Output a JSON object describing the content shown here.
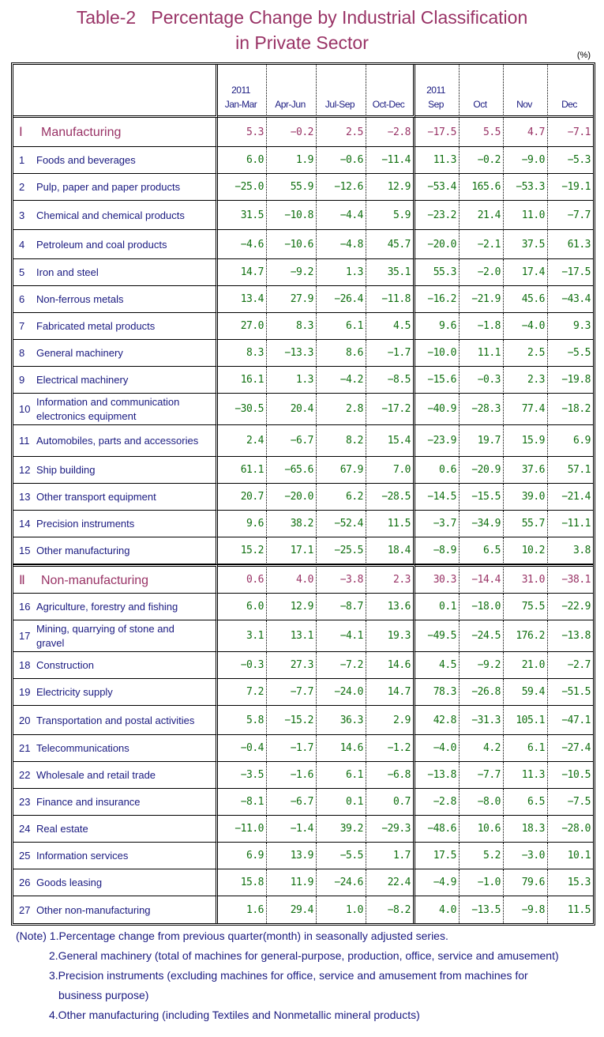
{
  "title": {
    "line1": "Table-2   Percentage Change by Industrial Classification",
    "line2": "in Private Sector"
  },
  "unit": "(%)",
  "header": {
    "columns": [
      {
        "year": "2011",
        "label": "Jan-Mar"
      },
      {
        "year": "",
        "label": "Apr-Jun"
      },
      {
        "year": "",
        "label": "Jul-Sep"
      },
      {
        "year": "",
        "label": "Oct-Dec"
      },
      {
        "year": "2011",
        "label": "Sep"
      },
      {
        "year": "",
        "label": "Oct"
      },
      {
        "year": "",
        "label": "Nov"
      },
      {
        "year": "",
        "label": "Dec"
      }
    ]
  },
  "sections": [
    {
      "roman": "Ⅰ",
      "name": "Manufacturing",
      "values": [
        "5.3",
        "−0.2",
        "2.5",
        "−2.8",
        "−17.5",
        "5.5",
        "4.7",
        "−7.1"
      ],
      "rows": [
        {
          "no": "1",
          "name": "Foods and beverages",
          "values": [
            "6.0",
            "1.9",
            "−0.6",
            "−11.4",
            "11.3",
            "−0.2",
            "−9.0",
            "−5.3"
          ]
        },
        {
          "no": "2",
          "name": "Pulp, paper and paper products",
          "values": [
            "−25.0",
            "55.9",
            "−12.6",
            "12.9",
            "−53.4",
            "165.6",
            "−53.3",
            "−19.1"
          ]
        },
        {
          "no": "3",
          "name": "Chemical and chemical products",
          "values": [
            "31.5",
            "−10.8",
            "−4.4",
            "5.9",
            "−23.2",
            "21.4",
            "11.0",
            "−7.7"
          ]
        },
        {
          "no": "4",
          "name": "Petroleum and coal products",
          "values": [
            "−4.6",
            "−10.6",
            "−4.8",
            "45.7",
            "−20.0",
            "−2.1",
            "37.5",
            "61.3"
          ]
        },
        {
          "no": "5",
          "name": "Iron and steel",
          "values": [
            "14.7",
            "−9.2",
            "1.3",
            "35.1",
            "55.3",
            "−2.0",
            "17.4",
            "−17.5"
          ]
        },
        {
          "no": "6",
          "name": "Non-ferrous metals",
          "values": [
            "13.4",
            "27.9",
            "−26.4",
            "−11.8",
            "−16.2",
            "−21.9",
            "45.6",
            "−43.4"
          ]
        },
        {
          "no": "7",
          "name": "Fabricated metal products",
          "values": [
            "27.0",
            "8.3",
            "6.1",
            "4.5",
            "9.6",
            "−1.8",
            "−4.0",
            "9.3"
          ]
        },
        {
          "no": "8",
          "name": "General machinery",
          "values": [
            "8.3",
            "−13.3",
            "8.6",
            "−1.7",
            "−10.0",
            "11.1",
            "2.5",
            "−5.5"
          ]
        },
        {
          "no": "9",
          "name": "Electrical machinery",
          "values": [
            "16.1",
            "1.3",
            "−4.2",
            "−8.5",
            "−15.6",
            "−0.3",
            "2.3",
            "−19.8"
          ]
        },
        {
          "no": "10",
          "name": "Information and communication electronics equipment",
          "wrap": true,
          "values": [
            "−30.5",
            "20.4",
            "2.8",
            "−17.2",
            "−40.9",
            "−28.3",
            "77.4",
            "−18.2"
          ]
        },
        {
          "no": "11",
          "name": "Automobiles, parts and accessories",
          "wrap": true,
          "values": [
            "2.4",
            "−6.7",
            "8.2",
            "15.4",
            "−23.9",
            "19.7",
            "15.9",
            "6.9"
          ]
        },
        {
          "no": "12",
          "name": "Ship building",
          "values": [
            "61.1",
            "−65.6",
            "67.9",
            "7.0",
            "0.6",
            "−20.9",
            "37.6",
            "57.1"
          ]
        },
        {
          "no": "13",
          "name": "Other transport equipment",
          "values": [
            "20.7",
            "−20.0",
            "6.2",
            "−28.5",
            "−14.5",
            "−15.5",
            "39.0",
            "−21.4"
          ]
        },
        {
          "no": "14",
          "name": "Precision instruments",
          "values": [
            "9.6",
            "38.2",
            "−52.4",
            "11.5",
            "−3.7",
            "−34.9",
            "55.7",
            "−11.1"
          ]
        },
        {
          "no": "15",
          "name": "Other manufacturing",
          "values": [
            "15.2",
            "17.1",
            "−25.5",
            "18.4",
            "−8.9",
            "6.5",
            "10.2",
            "3.8"
          ]
        }
      ]
    },
    {
      "roman": "Ⅱ",
      "name": "Non-manufacturing",
      "values": [
        "0.6",
        "4.0",
        "−3.8",
        "2.3",
        "30.3",
        "−14.4",
        "31.0",
        "−38.1"
      ],
      "rows": [
        {
          "no": "16",
          "name": "Agriculture, forestry and fishing",
          "values": [
            "6.0",
            "12.9",
            "−8.7",
            "13.6",
            "0.1",
            "−18.0",
            "75.5",
            "−22.9"
          ]
        },
        {
          "no": "17",
          "name": "Mining, quarrying of stone and gravel",
          "wrap": true,
          "values": [
            "3.1",
            "13.1",
            "−4.1",
            "19.3",
            "−49.5",
            "−24.5",
            "176.2",
            "−13.8"
          ]
        },
        {
          "no": "18",
          "name": "Construction",
          "values": [
            "−0.3",
            "27.3",
            "−7.2",
            "14.6",
            "4.5",
            "−9.2",
            "21.0",
            "−2.7"
          ]
        },
        {
          "no": "19",
          "name": "Electricity supply",
          "values": [
            "7.2",
            "−7.7",
            "−24.0",
            "14.7",
            "78.3",
            "−26.8",
            "59.4",
            "−51.5"
          ]
        },
        {
          "no": "20",
          "name": "Transportation and postal activities",
          "values": [
            "5.8",
            "−15.2",
            "36.3",
            "2.9",
            "42.8",
            "−31.3",
            "105.1",
            "−47.1"
          ]
        },
        {
          "no": "21",
          "name": "Telecommunications",
          "values": [
            "−0.4",
            "−1.7",
            "14.6",
            "−1.2",
            "−4.0",
            "4.2",
            "6.1",
            "−27.4"
          ]
        },
        {
          "no": "22",
          "name": "Wholesale and retail trade",
          "values": [
            "−3.5",
            "−1.6",
            "6.1",
            "−6.8",
            "−13.8",
            "−7.7",
            "11.3",
            "−10.5"
          ]
        },
        {
          "no": "23",
          "name": "Finance and insurance",
          "values": [
            "−8.1",
            "−6.7",
            "0.1",
            "0.7",
            "−2.8",
            "−8.0",
            "6.5",
            "−7.5"
          ]
        },
        {
          "no": "24",
          "name": "Real estate",
          "values": [
            "−11.0",
            "−1.4",
            "39.2",
            "−29.3",
            "−48.6",
            "10.6",
            "18.3",
            "−28.0"
          ]
        },
        {
          "no": "25",
          "name": "Information services",
          "values": [
            "6.9",
            "13.9",
            "−5.5",
            "1.7",
            "17.5",
            "5.2",
            "−3.0",
            "10.1"
          ]
        },
        {
          "no": "26",
          "name": "Goods leasing",
          "values": [
            "15.8",
            "11.9",
            "−24.6",
            "22.4",
            "−4.9",
            "−1.0",
            "79.6",
            "15.3"
          ]
        },
        {
          "no": "27",
          "name": "Other non-manufacturing",
          "values": [
            "1.6",
            "29.4",
            "1.0",
            "−8.2",
            "4.0",
            "−13.5",
            "−9.8",
            "11.5"
          ]
        }
      ]
    }
  ],
  "notes": {
    "prefix": "(Note)",
    "items": [
      "1.Percentage change from previous quarter(month) in seasonally adjusted series.",
      "2.General machinery (total of machines for general-purpose, production, office, service and amusement)",
      "3.Precision instruments (excluding machines for office, service and amusement from machines for",
      "business purpose)",
      "4.Other manufacturing (including Textiles and Nonmetallic mineral products)"
    ]
  },
  "colors": {
    "title": "#993366",
    "section": "#993366",
    "label": "#1a1a80",
    "value": "#107010"
  }
}
